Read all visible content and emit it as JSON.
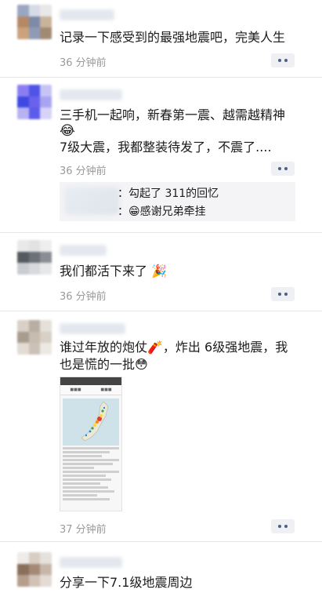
{
  "colors": {
    "time": "#9a9a9a",
    "action_dot": "#4b5f86",
    "divider": "#e6e6e6"
  },
  "posts": [
    {
      "text_lines": [
        "记录一下感受到的最强地震吧，完美人生"
      ],
      "time": "36 分钟前",
      "more_icon": "more-dots-icon"
    },
    {
      "text_lines": [
        "三手机一起响，新春第一震、越需越精神",
        "😂",
        "7级大震，我都整装待发了，不震了...."
      ],
      "time": "36 分钟前",
      "more_icon": "more-dots-icon",
      "comments": [
        {
          "text": "：勾起了 311的回忆"
        },
        {
          "text": "：😁感谢兄弟牵挂"
        }
      ]
    },
    {
      "text_lines": [
        "我们都活下来了 🎉"
      ],
      "time": "36 分钟前",
      "more_icon": "more-dots-icon"
    },
    {
      "text_lines": [
        "谁过年放的炮仗🧨，炸出 6级强地震，我",
        "也是慌的一批😳"
      ],
      "time": "37 分钟前",
      "more_icon": "more-dots-icon",
      "image": "earthquake-map-screenshot"
    },
    {
      "text_lines": [
        "分享一下7.1级地震周边"
      ]
    }
  ]
}
